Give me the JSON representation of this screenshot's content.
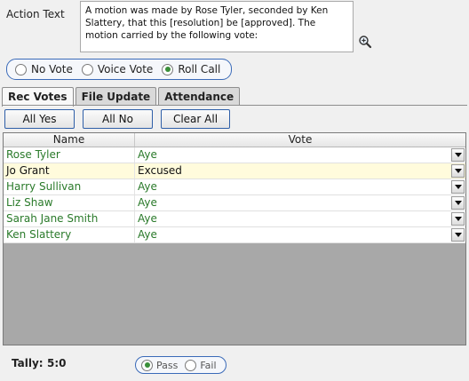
{
  "action": {
    "label": "Action Text",
    "text": "A motion was made by Rose Tyler, seconded by Ken Slattery, that this [resolution] be [approved]. The motion carried by the following vote:",
    "zoom_icon": "zoom-in-icon"
  },
  "vote_type": {
    "options": [
      {
        "label": "No Vote",
        "checked": false
      },
      {
        "label": "Voice Vote",
        "checked": false
      },
      {
        "label": "Roll Call",
        "checked": true
      }
    ]
  },
  "tabs": [
    {
      "label": "Rec Votes",
      "active": true
    },
    {
      "label": "File Update",
      "active": false
    },
    {
      "label": "Attendance",
      "active": false
    }
  ],
  "buttons": {
    "all_yes": "All Yes",
    "all_no": "All No",
    "clear_all": "Clear All"
  },
  "grid": {
    "columns": [
      "Name",
      "Vote"
    ],
    "rows": [
      {
        "name": "Rose Tyler",
        "vote": "Aye",
        "selected": false
      },
      {
        "name": "Jo Grant",
        "vote": "Excused",
        "selected": true
      },
      {
        "name": "Harry Sullivan",
        "vote": "Aye",
        "selected": false
      },
      {
        "name": "Liz Shaw",
        "vote": "Aye",
        "selected": false
      },
      {
        "name": "Sarah Jane Smith",
        "vote": "Aye",
        "selected": false
      },
      {
        "name": "Ken Slattery",
        "vote": "Aye",
        "selected": false
      }
    ]
  },
  "tally": {
    "label": "Tally:",
    "value": "5:0"
  },
  "result": {
    "options": [
      {
        "label": "Pass",
        "checked": true
      },
      {
        "label": "Fail",
        "checked": false
      }
    ]
  },
  "colors": {
    "accent_border": "#3a6ab8",
    "vote_text": "#2a7a2a",
    "selected_row": "#fffbdc",
    "grid_empty": "#a8a8a8"
  }
}
